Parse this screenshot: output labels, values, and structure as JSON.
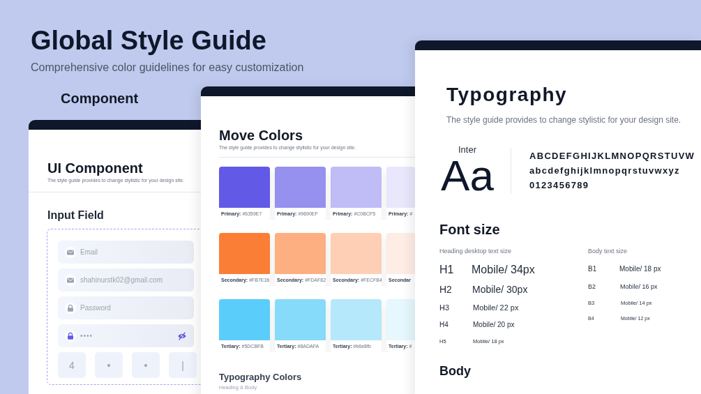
{
  "header": {
    "title": "Global Style Guide",
    "subtitle": "Comprehensive color guidelines for easy customization",
    "section_label": "Component"
  },
  "ui_component": {
    "title": "UI Component",
    "subtitle": "The style guide provides to change stylistic for your design site.",
    "section": "Input Field",
    "fields": [
      {
        "kind": "email",
        "placeholder": "Email"
      },
      {
        "kind": "email",
        "value": "shahinurstk02@gmail.com"
      },
      {
        "kind": "password",
        "placeholder": "Password"
      },
      {
        "kind": "password",
        "value": "••••"
      }
    ],
    "otp": [
      "4",
      "•",
      "•",
      "|"
    ]
  },
  "colors": {
    "title": "Move Colors",
    "subtitle": "The style guide provides to change stylistic for your design site.",
    "groups": [
      {
        "swatches": [
          {
            "color": "#6359e7",
            "label": "Primary:",
            "hex": "#6359E7"
          },
          {
            "color": "#9690ef",
            "label": "Primary:",
            "hex": "#9690EF"
          },
          {
            "color": "#c0bcf5",
            "label": "Primary:",
            "hex": "#C0BCF5"
          },
          {
            "color": "#e9e7fb",
            "label": "Primary:",
            "hex": "#"
          }
        ]
      },
      {
        "swatches": [
          {
            "color": "#fb7e36",
            "label": "Secondary:",
            "hex": "#FB7E36"
          },
          {
            "color": "#fdaf82",
            "label": "Secondary:",
            "hex": "#FDAF82"
          },
          {
            "color": "#fecfb4",
            "label": "Secondary:",
            "hex": "#FECFB4"
          },
          {
            "color": "#feede4",
            "label": "Secondar"
          }
        ]
      },
      {
        "swatches": [
          {
            "color": "#5bcdfa",
            "label": "Tertiary:",
            "hex": "#5DCBFB"
          },
          {
            "color": "#86dbfa",
            "label": "Tertiary:",
            "hex": "#8ADAFA"
          },
          {
            "color": "#b6e8fb",
            "label": "Tertiary:",
            "hex": "#b6e8fb"
          },
          {
            "color": "#e6f7fe",
            "label": "Tertiary:",
            "hex": "#"
          }
        ]
      }
    ],
    "typography_title": "Typography Colors",
    "typography_subtitle": "Heading & Body"
  },
  "typography": {
    "title": "Typography",
    "subtitle": "The style guide provides to change stylistic for your design site.",
    "font_name": "Inter",
    "sample": "Aa",
    "alphabet": [
      "ABCDEFGHIJKLMNOPQRSTUVW",
      "abcdefghijklmnopqrstuvwxyz",
      "0123456789"
    ],
    "font_size_title": "Font size",
    "heading_label": "Heading desktop text size",
    "headings": [
      {
        "tag": "H1",
        "size": "Mobile/ 34px"
      },
      {
        "tag": "H2",
        "size": "Mobile/ 30px"
      },
      {
        "tag": "H3",
        "size": "Mobile/ 22 px"
      },
      {
        "tag": "H4",
        "size": "Mobile/ 20 px"
      },
      {
        "tag": "H5",
        "size": "Mobile/ 18 px"
      }
    ],
    "body_label": "Body text size",
    "bodies": [
      {
        "tag": "B1",
        "size": "Mobile/ 18 px"
      },
      {
        "tag": "B2",
        "size": "Mobile/ 16 px"
      },
      {
        "tag": "B3",
        "size": "Mobile/ 14 px"
      },
      {
        "tag": "B4",
        "size": "Mobile/ 12 px"
      }
    ],
    "body_title": "Body"
  }
}
